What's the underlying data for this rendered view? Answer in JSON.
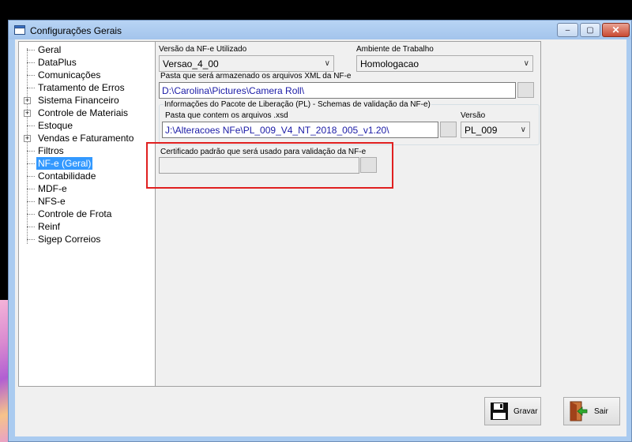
{
  "window": {
    "title": "Configurações Gerais",
    "minimize_glyph": "‒",
    "maximize_glyph": "▢",
    "close_glyph": "✕"
  },
  "tree": {
    "items": [
      {
        "label": "Geral",
        "expandable": false,
        "selected": false
      },
      {
        "label": "DataPlus",
        "expandable": false,
        "selected": false
      },
      {
        "label": "Comunicações",
        "expandable": false,
        "selected": false
      },
      {
        "label": "Tratamento de Erros",
        "expandable": false,
        "selected": false
      },
      {
        "label": "Sistema Financeiro",
        "expandable": true,
        "selected": false
      },
      {
        "label": "Controle de Materiais",
        "expandable": true,
        "selected": false
      },
      {
        "label": "Estoque",
        "expandable": false,
        "selected": false
      },
      {
        "label": "Vendas e Faturamento",
        "expandable": true,
        "selected": false
      },
      {
        "label": "Filtros",
        "expandable": false,
        "selected": false
      },
      {
        "label": "NF-e (Geral)",
        "expandable": false,
        "selected": true
      },
      {
        "label": "Contabilidade",
        "expandable": false,
        "selected": false
      },
      {
        "label": "MDF-e",
        "expandable": false,
        "selected": false
      },
      {
        "label": "NFS-e",
        "expandable": false,
        "selected": false
      },
      {
        "label": "Controle de Frota",
        "expandable": false,
        "selected": false
      },
      {
        "label": "Reinf",
        "expandable": false,
        "selected": false
      },
      {
        "label": "Sigep Correios",
        "expandable": false,
        "selected": false
      }
    ]
  },
  "form": {
    "versao_label": "Versão da NF-e Utilizado",
    "versao_value": "Versao_4_00",
    "ambiente_label": "Ambiente de Trabalho",
    "ambiente_value": "Homologacao",
    "pasta_xml_label": "Pasta que será armazenado os arquivos XML da NF-e",
    "pasta_xml_value": "D:\\Carolina\\Pictures\\Camera Roll\\",
    "pl_group_title": "Informações do Pacote de Liberação (PL) - Schemas de validação da NF-e)",
    "pasta_xsd_label": "Pasta que contem os arquivos .xsd",
    "pasta_xsd_value": "J:\\Alteracoes NFe\\PL_009_V4_NT_2018_005_v1.20\\",
    "versao_pl_label": "Versão",
    "versao_pl_value": "PL_009",
    "certificado_label": "Certificado padrão que será usado para validação da NF-e",
    "certificado_value": ""
  },
  "actions": {
    "gravar_label": "Gravar",
    "sair_label": "Sair"
  },
  "colors": {
    "selection": "#3399ff",
    "highlight_border": "#e02020",
    "path_text": "#1a1aa6"
  }
}
